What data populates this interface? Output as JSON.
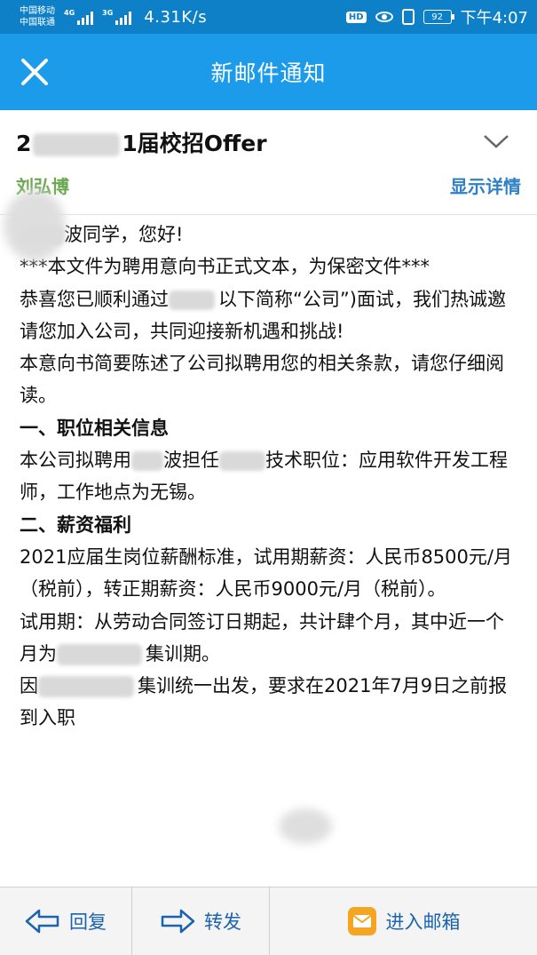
{
  "status_bar": {
    "carrier_1": "中国移动",
    "carrier_2": "中国联通",
    "signal_1_tag": "4G",
    "signal_2_tag": "3G",
    "net_speed": "4.31K/s",
    "hd_badge": "HD",
    "battery": "92",
    "time": "下午4:07"
  },
  "header": {
    "title": "新邮件通知"
  },
  "mail": {
    "subject_visible_prefix": "2",
    "subject_visible_suffix": "1届校招Offer",
    "sender": "刘弘博",
    "show_details": "显示详情",
    "body": {
      "greeting_suffix": "波同学，您好!",
      "confidential": "***本文件为聘用意向书正式文本，为保密文件***",
      "congrats_prefix": "恭喜您已顺利通过",
      "congrats_suffix": "以下简称“公司”)面试，我们热诚邀请您加入公司，共同迎接新机遇和挑战!",
      "intro": "本意向书简要陈述了公司拟聘用您的相关条款，请您仔细阅读。",
      "section_1": "一、职位相关信息",
      "position_prefix": "本公司拟聘用",
      "position_middle": "波担任",
      "position_suffix": "技术职位：应用软件开发工程师，工作地点为无锡。",
      "section_2": "二、薪资福利",
      "salary": "2021应届生岗位薪酬标准，试用期薪资：人民币8500元/月（税前），转正期薪资：人民币9000元/月（税前）。",
      "probation_prefix": "试用期：从劳动合同签订日期起，共计肆个月，其中近一个月为",
      "probation_suffix": "集训期。",
      "training_prefix": "因",
      "training_suffix": "集训统一出发，要求在2021年7月9日之前报到入职"
    }
  },
  "toolbar": {
    "reply": "回复",
    "forward": "转发",
    "inbox": "进入邮箱"
  },
  "colors": {
    "status_bar": "#0e80c8",
    "title_bar": "#1b9bea",
    "sender": "#6aa84f",
    "link": "#2f7fc4",
    "toolbar_text": "#1a63b0",
    "mail_icon": "#f4a623"
  }
}
